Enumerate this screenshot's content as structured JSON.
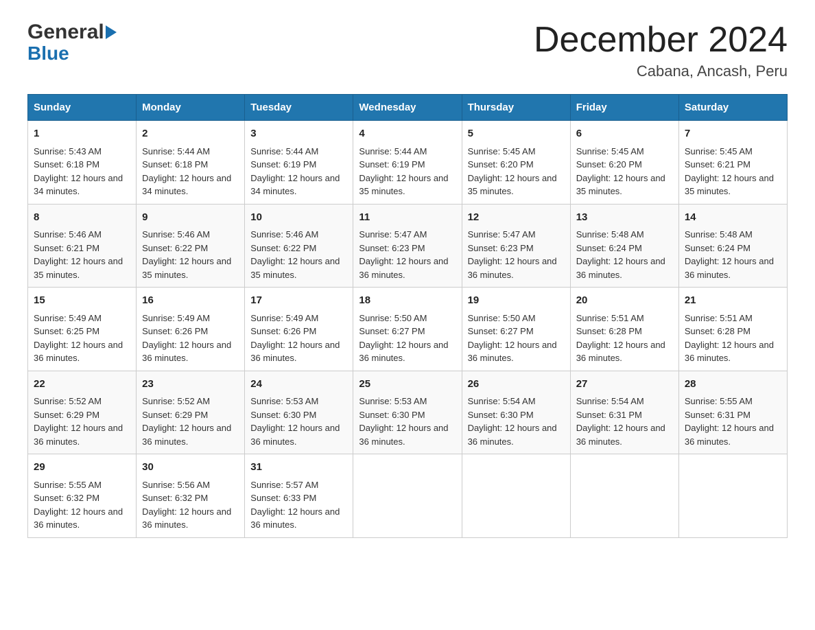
{
  "header": {
    "logo_general": "General",
    "logo_blue": "Blue",
    "main_title": "December 2024",
    "subtitle": "Cabana, Ancash, Peru"
  },
  "calendar": {
    "days": [
      "Sunday",
      "Monday",
      "Tuesday",
      "Wednesday",
      "Thursday",
      "Friday",
      "Saturday"
    ],
    "weeks": [
      [
        {
          "day": 1,
          "sunrise": "5:43 AM",
          "sunset": "6:18 PM",
          "daylight": "12 hours and 34 minutes."
        },
        {
          "day": 2,
          "sunrise": "5:44 AM",
          "sunset": "6:18 PM",
          "daylight": "12 hours and 34 minutes."
        },
        {
          "day": 3,
          "sunrise": "5:44 AM",
          "sunset": "6:19 PM",
          "daylight": "12 hours and 34 minutes."
        },
        {
          "day": 4,
          "sunrise": "5:44 AM",
          "sunset": "6:19 PM",
          "daylight": "12 hours and 35 minutes."
        },
        {
          "day": 5,
          "sunrise": "5:45 AM",
          "sunset": "6:20 PM",
          "daylight": "12 hours and 35 minutes."
        },
        {
          "day": 6,
          "sunrise": "5:45 AM",
          "sunset": "6:20 PM",
          "daylight": "12 hours and 35 minutes."
        },
        {
          "day": 7,
          "sunrise": "5:45 AM",
          "sunset": "6:21 PM",
          "daylight": "12 hours and 35 minutes."
        }
      ],
      [
        {
          "day": 8,
          "sunrise": "5:46 AM",
          "sunset": "6:21 PM",
          "daylight": "12 hours and 35 minutes."
        },
        {
          "day": 9,
          "sunrise": "5:46 AM",
          "sunset": "6:22 PM",
          "daylight": "12 hours and 35 minutes."
        },
        {
          "day": 10,
          "sunrise": "5:46 AM",
          "sunset": "6:22 PM",
          "daylight": "12 hours and 35 minutes."
        },
        {
          "day": 11,
          "sunrise": "5:47 AM",
          "sunset": "6:23 PM",
          "daylight": "12 hours and 36 minutes."
        },
        {
          "day": 12,
          "sunrise": "5:47 AM",
          "sunset": "6:23 PM",
          "daylight": "12 hours and 36 minutes."
        },
        {
          "day": 13,
          "sunrise": "5:48 AM",
          "sunset": "6:24 PM",
          "daylight": "12 hours and 36 minutes."
        },
        {
          "day": 14,
          "sunrise": "5:48 AM",
          "sunset": "6:24 PM",
          "daylight": "12 hours and 36 minutes."
        }
      ],
      [
        {
          "day": 15,
          "sunrise": "5:49 AM",
          "sunset": "6:25 PM",
          "daylight": "12 hours and 36 minutes."
        },
        {
          "day": 16,
          "sunrise": "5:49 AM",
          "sunset": "6:26 PM",
          "daylight": "12 hours and 36 minutes."
        },
        {
          "day": 17,
          "sunrise": "5:49 AM",
          "sunset": "6:26 PM",
          "daylight": "12 hours and 36 minutes."
        },
        {
          "day": 18,
          "sunrise": "5:50 AM",
          "sunset": "6:27 PM",
          "daylight": "12 hours and 36 minutes."
        },
        {
          "day": 19,
          "sunrise": "5:50 AM",
          "sunset": "6:27 PM",
          "daylight": "12 hours and 36 minutes."
        },
        {
          "day": 20,
          "sunrise": "5:51 AM",
          "sunset": "6:28 PM",
          "daylight": "12 hours and 36 minutes."
        },
        {
          "day": 21,
          "sunrise": "5:51 AM",
          "sunset": "6:28 PM",
          "daylight": "12 hours and 36 minutes."
        }
      ],
      [
        {
          "day": 22,
          "sunrise": "5:52 AM",
          "sunset": "6:29 PM",
          "daylight": "12 hours and 36 minutes."
        },
        {
          "day": 23,
          "sunrise": "5:52 AM",
          "sunset": "6:29 PM",
          "daylight": "12 hours and 36 minutes."
        },
        {
          "day": 24,
          "sunrise": "5:53 AM",
          "sunset": "6:30 PM",
          "daylight": "12 hours and 36 minutes."
        },
        {
          "day": 25,
          "sunrise": "5:53 AM",
          "sunset": "6:30 PM",
          "daylight": "12 hours and 36 minutes."
        },
        {
          "day": 26,
          "sunrise": "5:54 AM",
          "sunset": "6:30 PM",
          "daylight": "12 hours and 36 minutes."
        },
        {
          "day": 27,
          "sunrise": "5:54 AM",
          "sunset": "6:31 PM",
          "daylight": "12 hours and 36 minutes."
        },
        {
          "day": 28,
          "sunrise": "5:55 AM",
          "sunset": "6:31 PM",
          "daylight": "12 hours and 36 minutes."
        }
      ],
      [
        {
          "day": 29,
          "sunrise": "5:55 AM",
          "sunset": "6:32 PM",
          "daylight": "12 hours and 36 minutes."
        },
        {
          "day": 30,
          "sunrise": "5:56 AM",
          "sunset": "6:32 PM",
          "daylight": "12 hours and 36 minutes."
        },
        {
          "day": 31,
          "sunrise": "5:57 AM",
          "sunset": "6:33 PM",
          "daylight": "12 hours and 36 minutes."
        },
        null,
        null,
        null,
        null
      ]
    ],
    "labels": {
      "sunrise": "Sunrise:",
      "sunset": "Sunset:",
      "daylight": "Daylight:"
    }
  }
}
